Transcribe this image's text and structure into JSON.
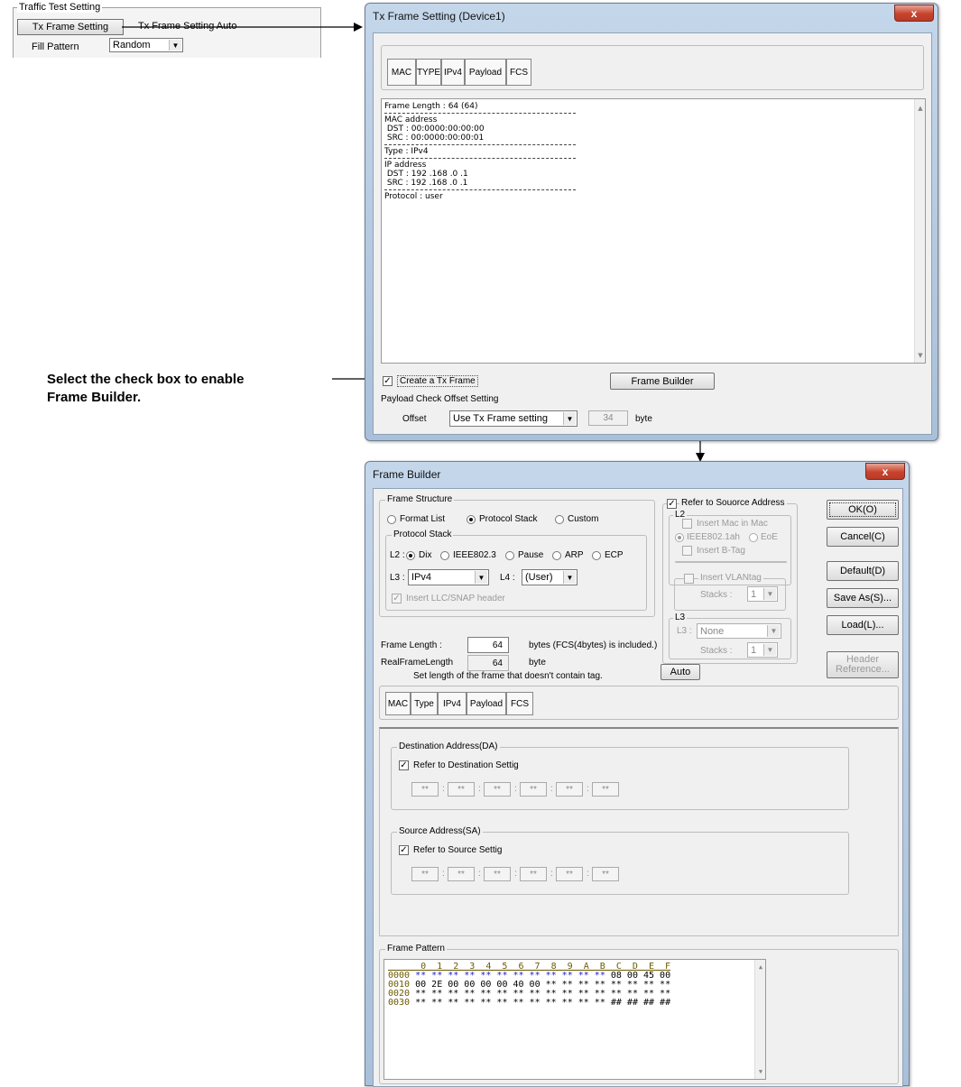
{
  "traffic_panel": {
    "legend": "Traffic Test Setting",
    "tab_active": "Tx Frame Setting",
    "tab_other": "Tx Frame Setting Auto",
    "fill_pattern_label": "Fill Pattern",
    "fill_pattern_value": "Random"
  },
  "annotation": {
    "line1": "Select the check box to enable",
    "line2": "Frame Builder."
  },
  "tx_window": {
    "title": "Tx Frame Setting (Device1)",
    "close": "x",
    "tabs": [
      "MAC",
      "TYPE",
      "IPv4",
      "Payload",
      "FCS"
    ],
    "info": {
      "frame_length": "Frame Length : 64 (64)",
      "mac_header": "MAC address",
      "mac_dst": " DST : 00:0000:00:00:00",
      "mac_src": " SRC : 00:0000:00:00:01",
      "type": "Type : IPv4",
      "ip_header": "IP address",
      "ip_dst": " DST : 192 .168 .0 .1",
      "ip_src": " SRC : 192 .168 .0 .1",
      "protocol": "Protocol : user"
    },
    "create_tx_frame": "Create a Tx Frame",
    "create_tx_frame_checked": true,
    "frame_builder_button": "Frame Builder",
    "payload_check_label": "Payload Check Offset Setting",
    "offset_label": "Offset",
    "offset_value": "Use Tx Frame setting",
    "offset_number": "34",
    "offset_unit": "byte"
  },
  "fb_window": {
    "title": "Frame Builder",
    "close": "x",
    "frame_structure": {
      "legend": "Frame Structure",
      "options": [
        "Format List",
        "Protocol Stack",
        "Custom"
      ],
      "selected": "Protocol Stack"
    },
    "protocol_stack": {
      "legend": "Protocol Stack",
      "l2_label": "L2 :",
      "l2_options": [
        "Dix",
        "IEEE802.3",
        "Pause",
        "ARP",
        "ECP"
      ],
      "l2_selected": "Dix",
      "l3_label": "L3 :",
      "l3_value": "IPv4",
      "l4_label": "L4 :",
      "l4_value": "(User)",
      "insert_llc": "Insert LLC/SNAP header"
    },
    "refer_source": {
      "label": "Refer to Souorce Address",
      "checked": true,
      "l2_legend": "L2",
      "insert_mac_in_mac": "Insert Mac in Mac",
      "ieee_option": "IEEE802.1ah",
      "eoe_option": "EoE",
      "insert_btag": "Insert B-Tag",
      "insert_vlantag": "Insert VLANtag",
      "stacks_label": "Stacks :",
      "stacks_value": "1",
      "l3_legend": "L3",
      "l3_label": "L3 :",
      "l3_value": "None",
      "l3_stacks_label": "Stacks :",
      "l3_stacks_value": "1"
    },
    "frame_length_label": "Frame Length :",
    "frame_length_value": "64",
    "frame_length_note": "bytes (FCS(4bytes) is included.)",
    "real_frame_length_label": "RealFrameLength",
    "real_frame_length_value": "64",
    "real_frame_length_unit": "byte",
    "note": "Set length of the frame that doesn't contain tag.",
    "auto_button": "Auto",
    "buttons": {
      "ok": "OK(O)",
      "cancel": "Cancel(C)",
      "default": "Default(D)",
      "save_as": "Save As(S)...",
      "load": "Load(L)...",
      "header_ref_1": "Header",
      "header_ref_2": "Reference..."
    },
    "tabs": [
      "MAC",
      "Type",
      "IPv4",
      "Payload",
      "FCS"
    ],
    "da": {
      "legend": "Destination Address(DA)",
      "refer": "Refer to Destination Settig",
      "checked": true,
      "octets": [
        "**",
        "**",
        "**",
        "**",
        "**",
        "**"
      ]
    },
    "sa": {
      "legend": "Source Address(SA)",
      "refer": "Refer to Source Settig",
      "checked": true,
      "octets": [
        "**",
        "**",
        "**",
        "**",
        "**",
        "**"
      ]
    },
    "frame_pattern": {
      "legend": "Frame Pattern",
      "header": "      0  1  2  3  4  5  6  7  8  9  A  B  C  D  E  F",
      "rows": [
        {
          "addr": "0000",
          "blue": "** ** ** ** ** ** ** ** ** ** ** **",
          "black": "08 00 45 00"
        },
        {
          "addr": "0010",
          "blue": "",
          "black": "00 2E 00 00 00 00 40 00 ** ** ** ** ** ** ** **"
        },
        {
          "addr": "0020",
          "blue": "",
          "black": "** ** ** ** ** ** ** ** ** ** ** ** ** ** ** **"
        },
        {
          "addr": "0030",
          "blue": "",
          "black": "** ** ** ** ** ** ** ** ** ** ** ** ## ## ## ##"
        }
      ]
    }
  },
  "colors": {
    "window_frame": "#a9c0da",
    "client": "#f0f0f0",
    "close": "#c7432e",
    "hex_blue": "#1a1acc",
    "hex_addr": "#6b5a00"
  }
}
